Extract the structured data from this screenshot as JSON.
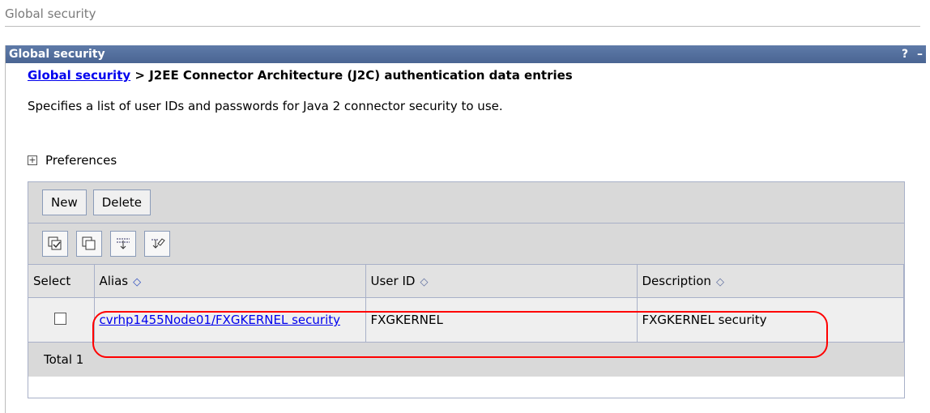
{
  "page_title": "Global security",
  "portlet": {
    "title": "Global security",
    "help_label": "?",
    "minimize_label": "–"
  },
  "breadcrumb": {
    "link": "Global security",
    "separator": ">",
    "current": "J2EE Connector Architecture (J2C) authentication data entries"
  },
  "description": "Specifies a list of user IDs and passwords for Java 2 connector security to use.",
  "preferences": {
    "expand_symbol": "+",
    "label": "Preferences"
  },
  "toolbar": {
    "new_label": "New",
    "delete_label": "Delete"
  },
  "icon_tools": [
    "select-all-icon",
    "deselect-all-icon",
    "show-filter-icon",
    "clear-filter-icon"
  ],
  "table": {
    "headers": {
      "select": "Select",
      "alias": "Alias",
      "user_id": "User ID",
      "description": "Description"
    },
    "sort_asc_icon": "◇",
    "rows": [
      {
        "alias": "cvrhp1455Node01/FXGKERNEL security",
        "user_id": "FXGKERNEL",
        "description": "FXGKERNEL security"
      }
    ],
    "total": "Total 1"
  },
  "colors": {
    "title_bar": "#4a6593",
    "link": "#0000ee",
    "highlight": "#ff0000"
  }
}
